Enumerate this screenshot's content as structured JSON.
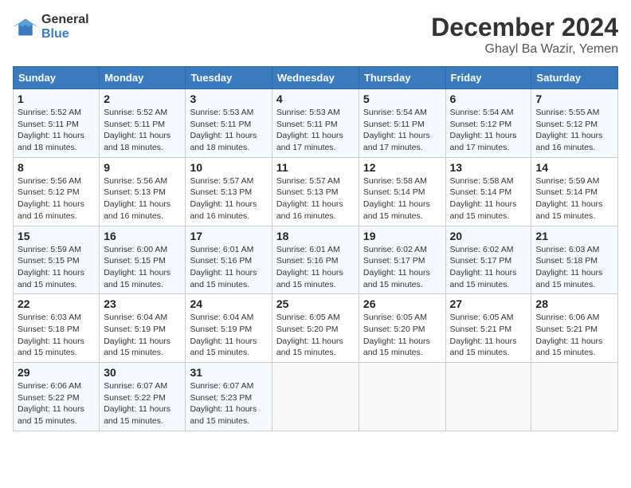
{
  "logo": {
    "general": "General",
    "blue": "Blue"
  },
  "title": "December 2024",
  "location": "Ghayl Ba Wazir, Yemen",
  "days_of_week": [
    "Sunday",
    "Monday",
    "Tuesday",
    "Wednesday",
    "Thursday",
    "Friday",
    "Saturday"
  ],
  "weeks": [
    [
      {
        "day": 1,
        "info": "Sunrise: 5:52 AM\nSunset: 5:11 PM\nDaylight: 11 hours\nand 18 minutes."
      },
      {
        "day": 2,
        "info": "Sunrise: 5:52 AM\nSunset: 5:11 PM\nDaylight: 11 hours\nand 18 minutes."
      },
      {
        "day": 3,
        "info": "Sunrise: 5:53 AM\nSunset: 5:11 PM\nDaylight: 11 hours\nand 18 minutes."
      },
      {
        "day": 4,
        "info": "Sunrise: 5:53 AM\nSunset: 5:11 PM\nDaylight: 11 hours\nand 17 minutes."
      },
      {
        "day": 5,
        "info": "Sunrise: 5:54 AM\nSunset: 5:11 PM\nDaylight: 11 hours\nand 17 minutes."
      },
      {
        "day": 6,
        "info": "Sunrise: 5:54 AM\nSunset: 5:12 PM\nDaylight: 11 hours\nand 17 minutes."
      },
      {
        "day": 7,
        "info": "Sunrise: 5:55 AM\nSunset: 5:12 PM\nDaylight: 11 hours\nand 16 minutes."
      }
    ],
    [
      {
        "day": 8,
        "info": "Sunrise: 5:56 AM\nSunset: 5:12 PM\nDaylight: 11 hours\nand 16 minutes."
      },
      {
        "day": 9,
        "info": "Sunrise: 5:56 AM\nSunset: 5:13 PM\nDaylight: 11 hours\nand 16 minutes."
      },
      {
        "day": 10,
        "info": "Sunrise: 5:57 AM\nSunset: 5:13 PM\nDaylight: 11 hours\nand 16 minutes."
      },
      {
        "day": 11,
        "info": "Sunrise: 5:57 AM\nSunset: 5:13 PM\nDaylight: 11 hours\nand 16 minutes."
      },
      {
        "day": 12,
        "info": "Sunrise: 5:58 AM\nSunset: 5:14 PM\nDaylight: 11 hours\nand 15 minutes."
      },
      {
        "day": 13,
        "info": "Sunrise: 5:58 AM\nSunset: 5:14 PM\nDaylight: 11 hours\nand 15 minutes."
      },
      {
        "day": 14,
        "info": "Sunrise: 5:59 AM\nSunset: 5:14 PM\nDaylight: 11 hours\nand 15 minutes."
      }
    ],
    [
      {
        "day": 15,
        "info": "Sunrise: 5:59 AM\nSunset: 5:15 PM\nDaylight: 11 hours\nand 15 minutes."
      },
      {
        "day": 16,
        "info": "Sunrise: 6:00 AM\nSunset: 5:15 PM\nDaylight: 11 hours\nand 15 minutes."
      },
      {
        "day": 17,
        "info": "Sunrise: 6:01 AM\nSunset: 5:16 PM\nDaylight: 11 hours\nand 15 minutes."
      },
      {
        "day": 18,
        "info": "Sunrise: 6:01 AM\nSunset: 5:16 PM\nDaylight: 11 hours\nand 15 minutes."
      },
      {
        "day": 19,
        "info": "Sunrise: 6:02 AM\nSunset: 5:17 PM\nDaylight: 11 hours\nand 15 minutes."
      },
      {
        "day": 20,
        "info": "Sunrise: 6:02 AM\nSunset: 5:17 PM\nDaylight: 11 hours\nand 15 minutes."
      },
      {
        "day": 21,
        "info": "Sunrise: 6:03 AM\nSunset: 5:18 PM\nDaylight: 11 hours\nand 15 minutes."
      }
    ],
    [
      {
        "day": 22,
        "info": "Sunrise: 6:03 AM\nSunset: 5:18 PM\nDaylight: 11 hours\nand 15 minutes."
      },
      {
        "day": 23,
        "info": "Sunrise: 6:04 AM\nSunset: 5:19 PM\nDaylight: 11 hours\nand 15 minutes."
      },
      {
        "day": 24,
        "info": "Sunrise: 6:04 AM\nSunset: 5:19 PM\nDaylight: 11 hours\nand 15 minutes."
      },
      {
        "day": 25,
        "info": "Sunrise: 6:05 AM\nSunset: 5:20 PM\nDaylight: 11 hours\nand 15 minutes."
      },
      {
        "day": 26,
        "info": "Sunrise: 6:05 AM\nSunset: 5:20 PM\nDaylight: 11 hours\nand 15 minutes."
      },
      {
        "day": 27,
        "info": "Sunrise: 6:05 AM\nSunset: 5:21 PM\nDaylight: 11 hours\nand 15 minutes."
      },
      {
        "day": 28,
        "info": "Sunrise: 6:06 AM\nSunset: 5:21 PM\nDaylight: 11 hours\nand 15 minutes."
      }
    ],
    [
      {
        "day": 29,
        "info": "Sunrise: 6:06 AM\nSunset: 5:22 PM\nDaylight: 11 hours\nand 15 minutes."
      },
      {
        "day": 30,
        "info": "Sunrise: 6:07 AM\nSunset: 5:22 PM\nDaylight: 11 hours\nand 15 minutes."
      },
      {
        "day": 31,
        "info": "Sunrise: 6:07 AM\nSunset: 5:23 PM\nDaylight: 11 hours\nand 15 minutes."
      },
      null,
      null,
      null,
      null
    ]
  ]
}
